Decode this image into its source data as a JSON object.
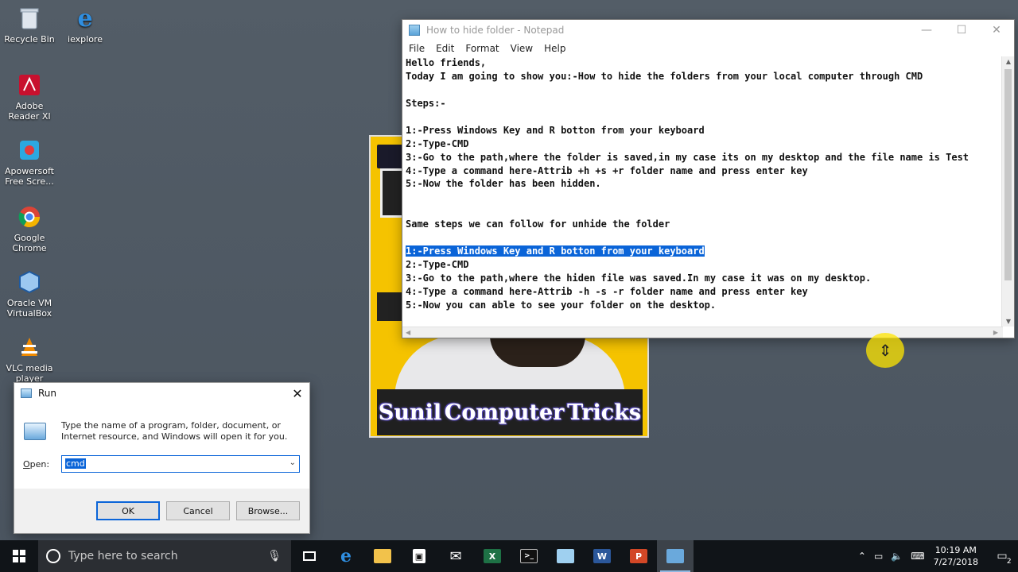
{
  "desktop": {
    "icons": [
      {
        "label": "Recycle Bin",
        "icon": "recycle-bin-icon"
      },
      {
        "label": "iexplore",
        "icon": "internet-explorer-icon"
      },
      {
        "label": "Adobe\nReader XI",
        "icon": "adobe-reader-icon"
      },
      {
        "label": "Apowersoft\nFree Scre...",
        "icon": "apowersoft-icon"
      },
      {
        "label": "Google\nChrome",
        "icon": "chrome-icon"
      },
      {
        "label": "Oracle VM\nVirtualBox",
        "icon": "virtualbox-icon"
      },
      {
        "label": "VLC media\nplayer",
        "icon": "vlc-icon"
      }
    ]
  },
  "photo_window": {
    "banner_words": [
      "Sunil",
      "Computer",
      "Tricks"
    ]
  },
  "notepad": {
    "title": "How to hide folder - Notepad",
    "menu": [
      "File",
      "Edit",
      "Format",
      "View",
      "Help"
    ],
    "window_buttons": {
      "minimize": "—",
      "maximize": "☐",
      "close": "✕"
    },
    "lines": [
      "Hello friends,",
      "Today I am going to show you:-How to hide the folders from your local computer through CMD",
      "",
      "Steps:-",
      "",
      "1:-Press Windows Key and R botton from your keyboard",
      "2:-Type-CMD",
      "3:-Go to the path,where the folder is saved,in my case its on my desktop and the file name is Test",
      "4:-Type a command here-Attrib +h +s +r folder name and press enter key",
      "5:-Now the folder has been hidden.",
      "",
      "",
      "Same steps we can follow for unhide the folder",
      "",
      "1:-Press Windows Key and R botton from your keyboard",
      "2:-Type-CMD",
      "3:-Go to the path,where the hiden file was saved.In my case it was on my desktop.",
      "4:-Type a command here-Attrib -h -s -r folder name and press enter key",
      "5:-Now you can able to see your folder on the desktop."
    ],
    "selected_line_index": 14
  },
  "run_dialog": {
    "title": "Run",
    "close": "✕",
    "description": "Type the name of a program, folder, document, or Internet resource, and Windows will open it for you.",
    "open_label_prefix": "",
    "open_label_underline": "O",
    "open_label_rest": "pen:",
    "input_value": "cmd",
    "buttons": {
      "ok": "OK",
      "cancel": "Cancel",
      "browse": "Browse..."
    }
  },
  "taskbar": {
    "search_placeholder": "Type here to search",
    "apps": [
      "task-view-icon",
      "edge-icon",
      "file-explorer-icon",
      "store-icon",
      "mail-icon",
      "excel-icon",
      "cmd-icon",
      "notepad-icon",
      "word-icon",
      "powerpoint-icon",
      "run-icon"
    ],
    "clock_time": "10:19 AM",
    "clock_date": "7/27/2018",
    "notification_count": "2"
  },
  "colors": {
    "selection": "#0a64d8",
    "desktop": "#4f5964",
    "taskbar": "#101418",
    "photo_bg": "#f5c300"
  }
}
